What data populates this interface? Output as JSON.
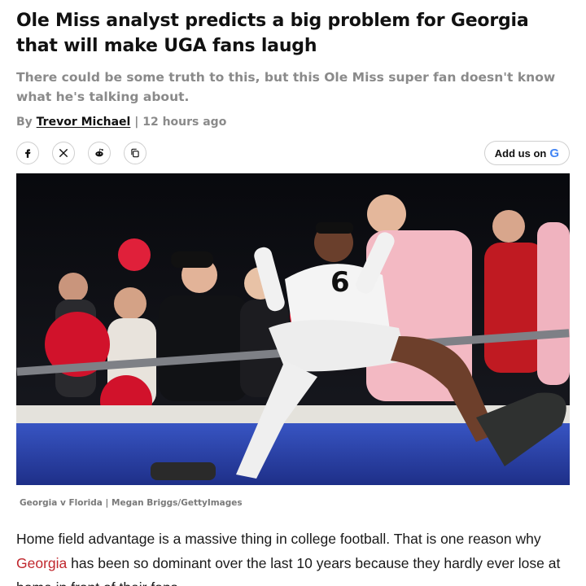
{
  "article": {
    "title": "Ole Miss analyst predicts a big problem for Georgia that will make UGA fans laugh",
    "subtitle": "There could be some truth to this, but this Ole Miss super fan doesn't know what he's talking about.",
    "byline_prefix": "By",
    "author": "Trevor Michael",
    "separator": "|",
    "timestamp": "12 hours ago"
  },
  "share": {
    "buttons": [
      {
        "icon": "facebook-icon"
      },
      {
        "icon": "x-icon"
      },
      {
        "icon": "reddit-icon"
      },
      {
        "icon": "copy-link-icon"
      }
    ],
    "add_us_label": "Add us on",
    "google_glyph": "G"
  },
  "hero": {
    "jersey_number": "6",
    "caption": "Georgia v Florida | Megan Briggs/GettyImages"
  },
  "body": {
    "p1_start": "Home field advantage is a massive thing in college football. That is one reason why ",
    "p1_link": "Georgia",
    "p1_end": " has been so dominant over the last 10 years because they hardly ever lose at home in front of their fans."
  },
  "colors": {
    "link": "#c0272d",
    "muted": "#8a8a8a",
    "uga_red": "#ba0c2f"
  }
}
